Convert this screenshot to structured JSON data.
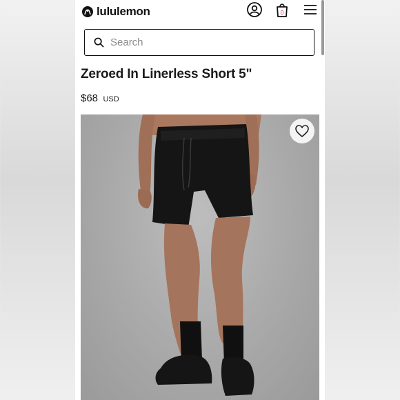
{
  "brand": {
    "name": "lululemon"
  },
  "header": {
    "account_icon": "account-icon",
    "bag_icon": "shopping-bag-icon",
    "bag_count": "0",
    "menu_icon": "hamburger-menu-icon"
  },
  "search": {
    "placeholder": "Search",
    "icon": "search-icon"
  },
  "product": {
    "title": "Zeroed In Linerless Short 5\"",
    "price": "$68",
    "currency": "USD",
    "wishlist_icon": "heart-icon"
  },
  "colors": {
    "text": "#1a1a1a",
    "accent": "#d31f3a",
    "photo_bg": "#adadad"
  }
}
